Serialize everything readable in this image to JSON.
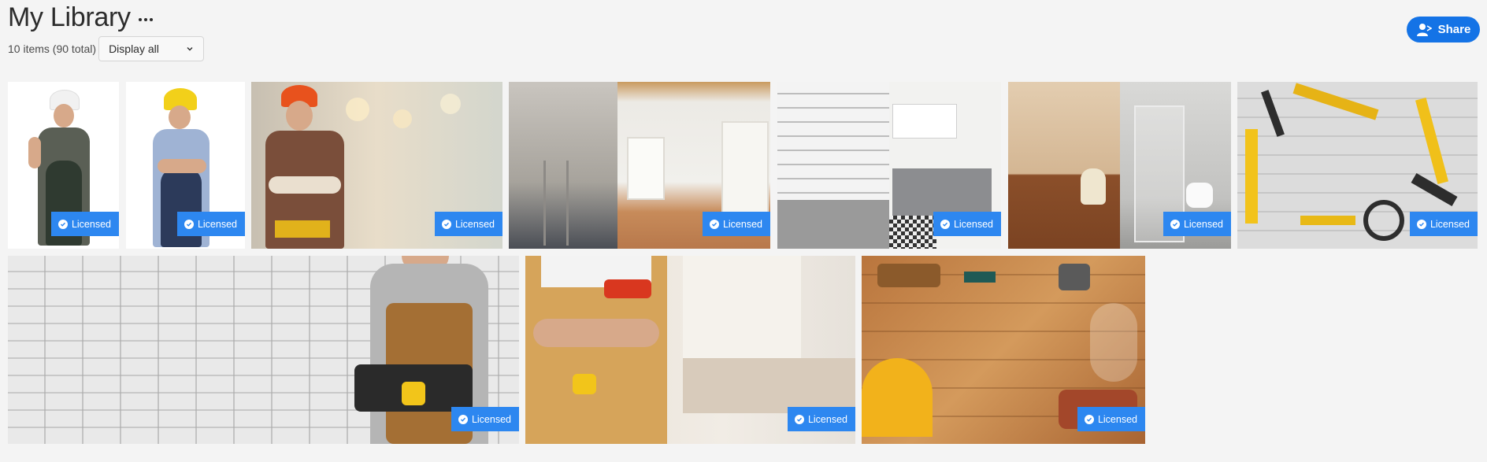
{
  "header": {
    "title": "My Library",
    "item_count": "10 items (90 total)",
    "filter_value": "Display all",
    "share_label": "Share"
  },
  "tiles": [
    {
      "badge": "Licensed",
      "icon": "check-circle-icon"
    },
    {
      "badge": "Licensed",
      "icon": "check-circle-icon"
    },
    {
      "badge": "Licensed",
      "icon": "check-circle-icon"
    },
    {
      "badge": "Licensed",
      "icon": "check-circle-icon"
    },
    {
      "badge": "Licensed",
      "icon": "check-circle-icon"
    },
    {
      "badge": "Licensed",
      "icon": "check-circle-icon"
    },
    {
      "badge": "Licensed",
      "icon": "check-circle-icon"
    },
    {
      "badge": "Licensed",
      "icon": "check-circle-icon"
    },
    {
      "badge": "Licensed",
      "icon": "check-circle-icon"
    },
    {
      "badge": "Licensed",
      "icon": "check-circle-icon"
    }
  ],
  "colors": {
    "accent": "#1473e6",
    "badge": "#2d87f0",
    "background": "#f4f4f4"
  }
}
